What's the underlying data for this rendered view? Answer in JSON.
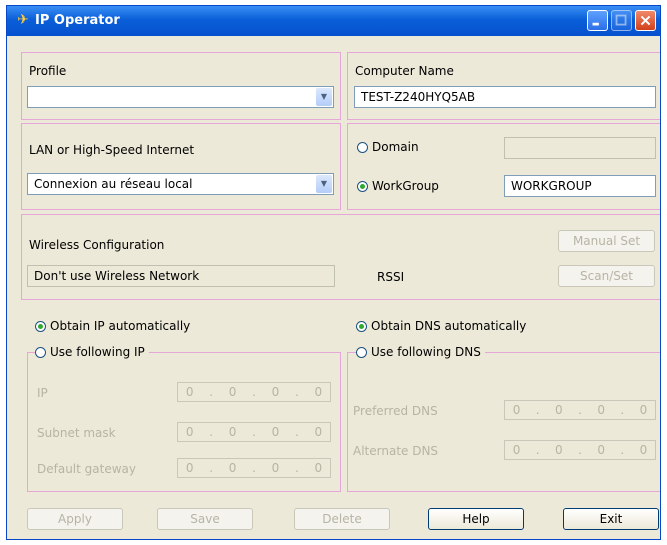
{
  "window": {
    "title": "IP Operator"
  },
  "profile": {
    "label": "Profile",
    "value": ""
  },
  "computer_name": {
    "label": "Computer Name",
    "value": "TEST-Z240HYQ5AB"
  },
  "lan": {
    "label": "LAN or High-Speed Internet",
    "value": "Connexion au réseau local"
  },
  "domain": {
    "label": "Domain",
    "value": ""
  },
  "workgroup": {
    "label": "WorkGroup",
    "value": "WORKGROUP"
  },
  "wireless": {
    "label": "Wireless Configuration",
    "value": "Don't use Wireless Network",
    "rssi_label": "RSSI",
    "manual_set": "Manual Set",
    "scan_set": "Scan/Set"
  },
  "ip": {
    "obtain_auto": "Obtain IP automatically",
    "use_following": "Use following IP",
    "ip_label": "IP",
    "subnet_label": "Subnet mask",
    "gateway_label": "Default gateway",
    "octet": "0",
    "dot": "."
  },
  "dns": {
    "obtain_auto": "Obtain DNS automatically",
    "use_following": "Use following DNS",
    "preferred_label": "Preferred DNS",
    "alternate_label": "Alternate DNS"
  },
  "buttons": {
    "apply": "Apply",
    "save": "Save",
    "delete": "Delete",
    "help": "Help",
    "exit": "Exit"
  },
  "colors": {
    "title_bar": "#0a5fd8",
    "panel_border": "#e7a6d8",
    "window_bg": "#ece9d8",
    "radio_selected": "#2fa82f"
  }
}
